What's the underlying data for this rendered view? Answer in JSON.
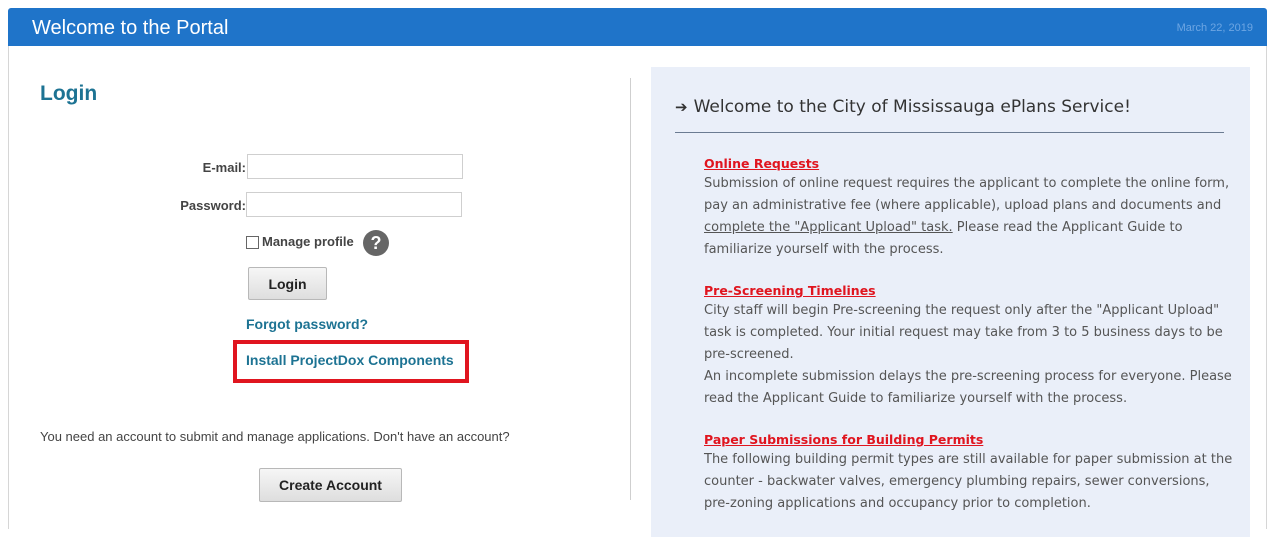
{
  "header": {
    "title": "Welcome to the Portal",
    "date": "March 22, 2019"
  },
  "login": {
    "title": "Login",
    "email_label": "E-mail:",
    "email_value": "",
    "password_label": "Password:",
    "password_value": "",
    "manage_profile_label": "Manage profile",
    "manage_profile_checked": false,
    "help_glyph": "?",
    "login_button": "Login",
    "forgot_password": "Forgot password?",
    "install_components": "Install ProjectDox Components",
    "account_text": "You need an account to submit and manage applications. Don't have an account?",
    "create_account_button": "Create Account"
  },
  "panel": {
    "heading": "Welcome to the City of Mississauga ePlans Service!",
    "sections": [
      {
        "title": "Online Requests",
        "text_before_link": "Submission of online request requires the applicant to complete the online form, pay an administrative fee (where applicable), upload plans and documents and ",
        "link": "complete the \"Applicant Upload\" task.",
        "text_after_link": " Please read the Applicant Guide to familiarize yourself with the process."
      },
      {
        "title": "Pre-Screening Timelines",
        "text": "City staff will begin Pre-screening the request only after the \"Applicant Upload\" task is completed. Your initial request may take from 3 to 5 business days to be pre-screened.",
        "text2": "An incomplete submission delays the pre-screening process for everyone. Please read the Applicant Guide to familiarize yourself with the process."
      },
      {
        "title": "Paper Submissions for Building Permits",
        "text": "The following building permit types are still available for paper submission at the counter -  backwater valves, emergency plumbing repairs, sewer conversions, pre-zoning applications and occupancy prior to completion."
      }
    ]
  },
  "colors": {
    "header_bg": "#1f74c9",
    "accent_teal": "#1d7393",
    "highlight_red": "#e0151f",
    "panel_bg": "#eaeff9"
  }
}
